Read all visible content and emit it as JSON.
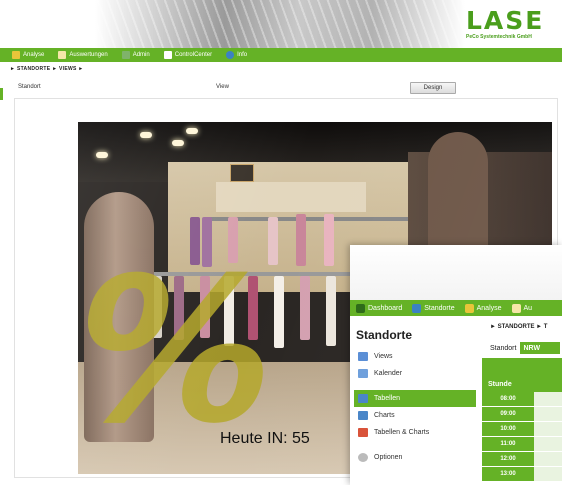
{
  "logo": {
    "text": "LASE",
    "subtitle": "PeCo Systemtechnik GmbH"
  },
  "mainnav": {
    "items": [
      {
        "label": "Analyse",
        "icon": "chart-icon",
        "color": "#e9c53a"
      },
      {
        "label": "Auswertungen",
        "icon": "document-icon",
        "color": "#f5e6a8"
      },
      {
        "label": "Admin",
        "icon": "users-icon",
        "color": "#7fb36a"
      },
      {
        "label": "ControlCenter",
        "icon": "monitor-icon",
        "color": "#ffffff"
      },
      {
        "label": "Info",
        "icon": "help-icon",
        "color": "#3b82c4"
      }
    ]
  },
  "breadcrumb": "► STANDORTE ► VIEWS ►",
  "fields": {
    "standort_label": "Standort",
    "view_label": "View",
    "design_button": "Design"
  },
  "photo": {
    "counter_text": "Heute IN: 55",
    "overlay_symbol": "%"
  },
  "overlay": {
    "nav": [
      {
        "label": "Dashboard",
        "icon": "dashboard-icon",
        "color": "#2f6b1a"
      },
      {
        "label": "Standorte",
        "icon": "location-icon",
        "color": "#3b82c4"
      },
      {
        "label": "Analyse",
        "icon": "chart-icon",
        "color": "#e9c53a"
      },
      {
        "label": "Au",
        "icon": "document-icon",
        "color": "#f5e6a8"
      }
    ],
    "title": "Standorte",
    "breadcrumb": "► STANDORTE ► T",
    "filter_label": "Standort",
    "filter_value": "NRW",
    "menu": [
      {
        "label": "Views",
        "icon": "views-icon",
        "color": "#5b8fd6"
      },
      {
        "label": "Kalender",
        "icon": "calendar-icon",
        "color": "#6fa0dc"
      },
      {
        "label": "Tabellen",
        "icon": "table-icon",
        "color": "#4a86c8",
        "active": true
      },
      {
        "label": "Charts",
        "icon": "bar-chart-icon",
        "color": "#4a86c8"
      },
      {
        "label": "Tabellen & Charts",
        "icon": "table-chart-icon",
        "color": "#d9533a"
      },
      {
        "label": "Optionen",
        "icon": "options-icon",
        "color": "#bbbbbb"
      }
    ],
    "table": {
      "header": "Stunde",
      "hours": [
        "08:00",
        "09:00",
        "10:00",
        "11:00",
        "12:00",
        "13:00"
      ]
    }
  }
}
